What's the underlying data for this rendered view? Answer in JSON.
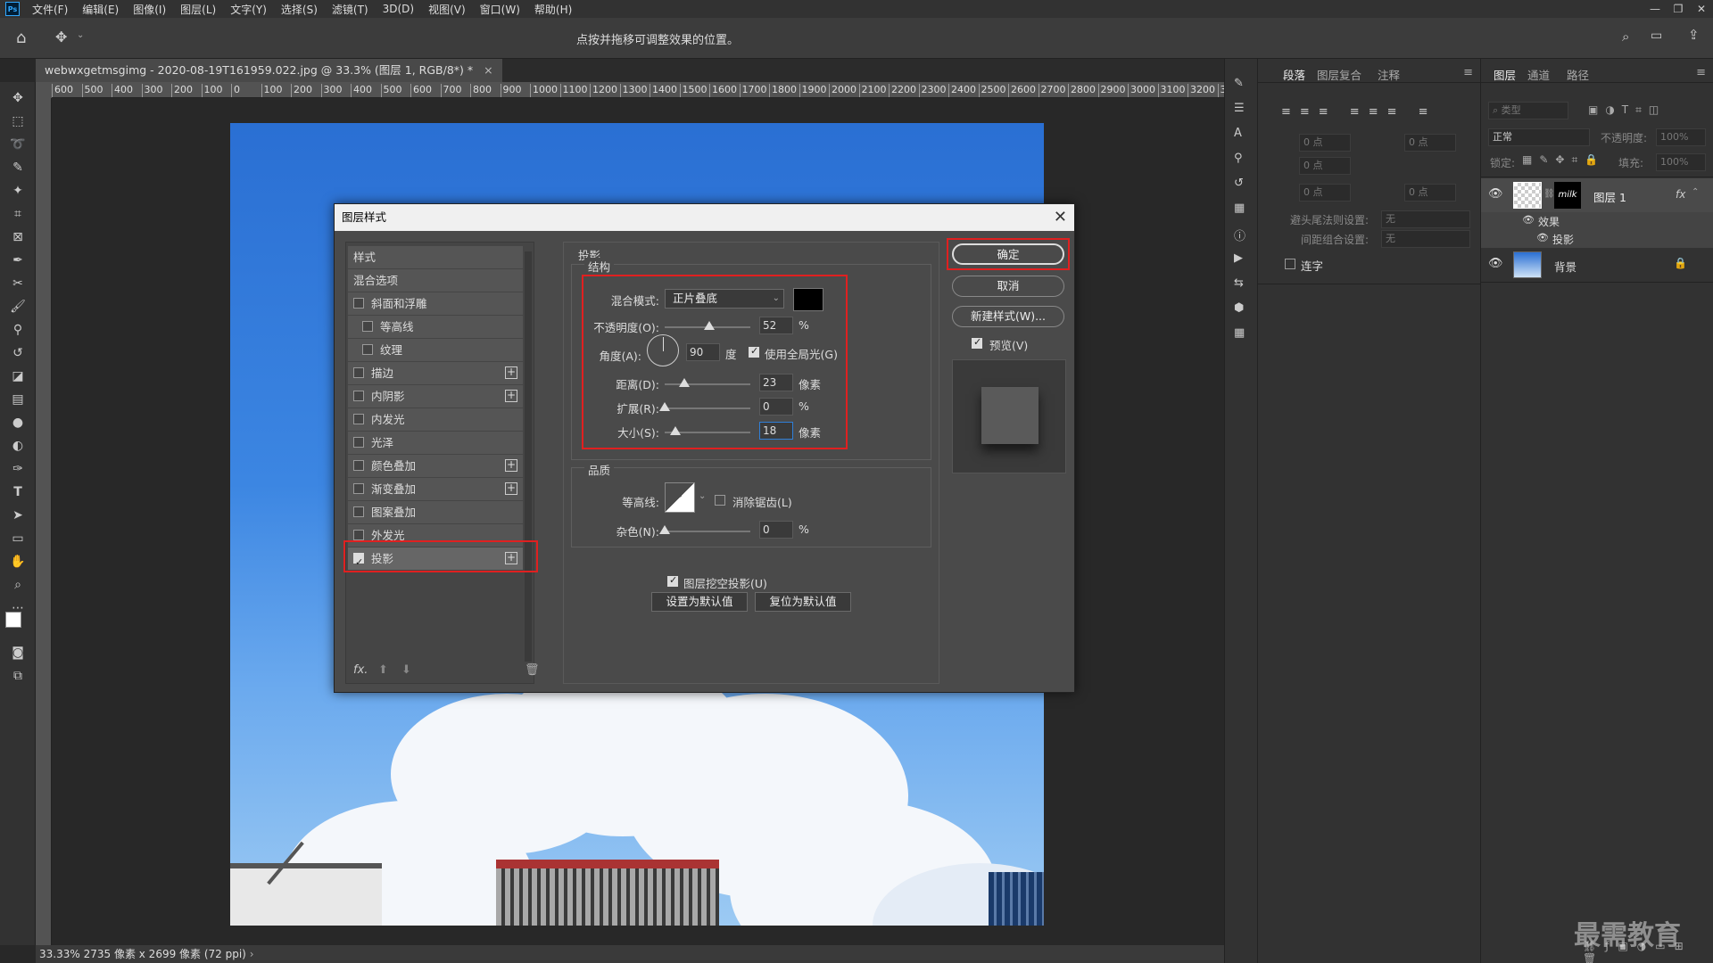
{
  "menubar": {
    "logo": "Ps",
    "items": [
      "文件(F)",
      "编辑(E)",
      "图像(I)",
      "图层(L)",
      "文字(Y)",
      "选择(S)",
      "滤镜(T)",
      "3D(D)",
      "视图(V)",
      "窗口(W)",
      "帮助(H)"
    ]
  },
  "options_bar": {
    "hint": "点按并拖移可调整效果的位置。"
  },
  "document": {
    "tab_title": "webwxgetmsgimg - 2020-08-19T161959.022.jpg @ 33.3% (图层 1, RGB/8*) *",
    "tab_close": "×",
    "ruler_ticks": [
      "600",
      "500",
      "400",
      "300",
      "200",
      "100",
      "0",
      "100",
      "200",
      "300",
      "400",
      "500",
      "600",
      "700",
      "800",
      "900",
      "1000",
      "1100",
      "1200",
      "1300",
      "1400",
      "1500",
      "1600",
      "1700",
      "1800",
      "1900",
      "2000",
      "2100",
      "2200",
      "2300",
      "2400",
      "2500",
      "2600",
      "2700",
      "2800",
      "2900",
      "3000",
      "3100",
      "3200",
      "33"
    ]
  },
  "status_bar": {
    "zoom": "33.33%",
    "doc_info": "2735 像素 x 2699 像素 (72 ppi)"
  },
  "paragraph_panel": {
    "tabs": [
      "段落",
      "图层复合",
      "注释"
    ],
    "indent_value": "0 点",
    "hanging_label": "避头尾法则设置:",
    "hanging_value": "无",
    "spacing_label": "间距组合设置:",
    "spacing_value": "无",
    "hyphen_label": "连字"
  },
  "layers_panel": {
    "tabs": [
      "图层",
      "通道",
      "路径"
    ],
    "filter_placeholder": "类型",
    "blend_mode": "正常",
    "opacity_label": "不透明度:",
    "opacity_value": "100%",
    "lock_label": "锁定:",
    "fill_label": "填充:",
    "fill_value": "100%",
    "layers": [
      {
        "name": "图层 1",
        "mask_text": "milk",
        "fx": "fx",
        "effects_label": "效果",
        "effect": "投影"
      },
      {
        "name": "背景"
      }
    ]
  },
  "watermark": "最需教育",
  "dialog": {
    "title": "图层样式",
    "close": "✕",
    "style_list_header": "样式",
    "blend_options": "混合选项",
    "styles": [
      {
        "label": "斜面和浮雕",
        "checked": false,
        "plus": false,
        "indent": false
      },
      {
        "label": "等高线",
        "checked": false,
        "plus": false,
        "indent": true
      },
      {
        "label": "纹理",
        "checked": false,
        "plus": false,
        "indent": true
      },
      {
        "label": "描边",
        "checked": false,
        "plus": true,
        "indent": false
      },
      {
        "label": "内阴影",
        "checked": false,
        "plus": true,
        "indent": false
      },
      {
        "label": "内发光",
        "checked": false,
        "plus": false,
        "indent": false
      },
      {
        "label": "光泽",
        "checked": false,
        "plus": false,
        "indent": false
      },
      {
        "label": "颜色叠加",
        "checked": false,
        "plus": true,
        "indent": false
      },
      {
        "label": "渐变叠加",
        "checked": false,
        "plus": true,
        "indent": false
      },
      {
        "label": "图案叠加",
        "checked": false,
        "plus": false,
        "indent": false
      },
      {
        "label": "外发光",
        "checked": false,
        "plus": false,
        "indent": false
      },
      {
        "label": "投影",
        "checked": true,
        "plus": true,
        "indent": false
      }
    ],
    "footer_fx": "fx.",
    "section_title": "投影",
    "structure_title": "结构",
    "blend_mode_label": "混合模式:",
    "blend_mode_value": "正片叠底",
    "shadow_color": "#000000",
    "opacity_label": "不透明度(O):",
    "opacity_value": "52",
    "opacity_unit": "%",
    "opacity_fraction": 0.52,
    "angle_label": "角度(A):",
    "angle_value": "90",
    "angle_unit": "度",
    "global_light_label": "使用全局光(G)",
    "distance_label": "距离(D):",
    "distance_value": "23",
    "distance_unit": "像素",
    "distance_fraction": 0.23,
    "spread_label": "扩展(R):",
    "spread_value": "0",
    "spread_unit": "%",
    "spread_fraction": 0,
    "size_label": "大小(S):",
    "size_value": "18",
    "size_unit": "像素",
    "size_fraction": 0.12,
    "quality_title": "品质",
    "contour_label": "等高线:",
    "antialias_label": "消除锯齿(L)",
    "noise_label": "杂色(N):",
    "noise_value": "0",
    "noise_unit": "%",
    "noise_fraction": 0,
    "knockout_label": "图层挖空投影(U)",
    "set_default": "设置为默认值",
    "reset_default": "复位为默认值",
    "ok": "确定",
    "cancel": "取消",
    "new_style": "新建样式(W)...",
    "preview_label": "预览(V)"
  }
}
